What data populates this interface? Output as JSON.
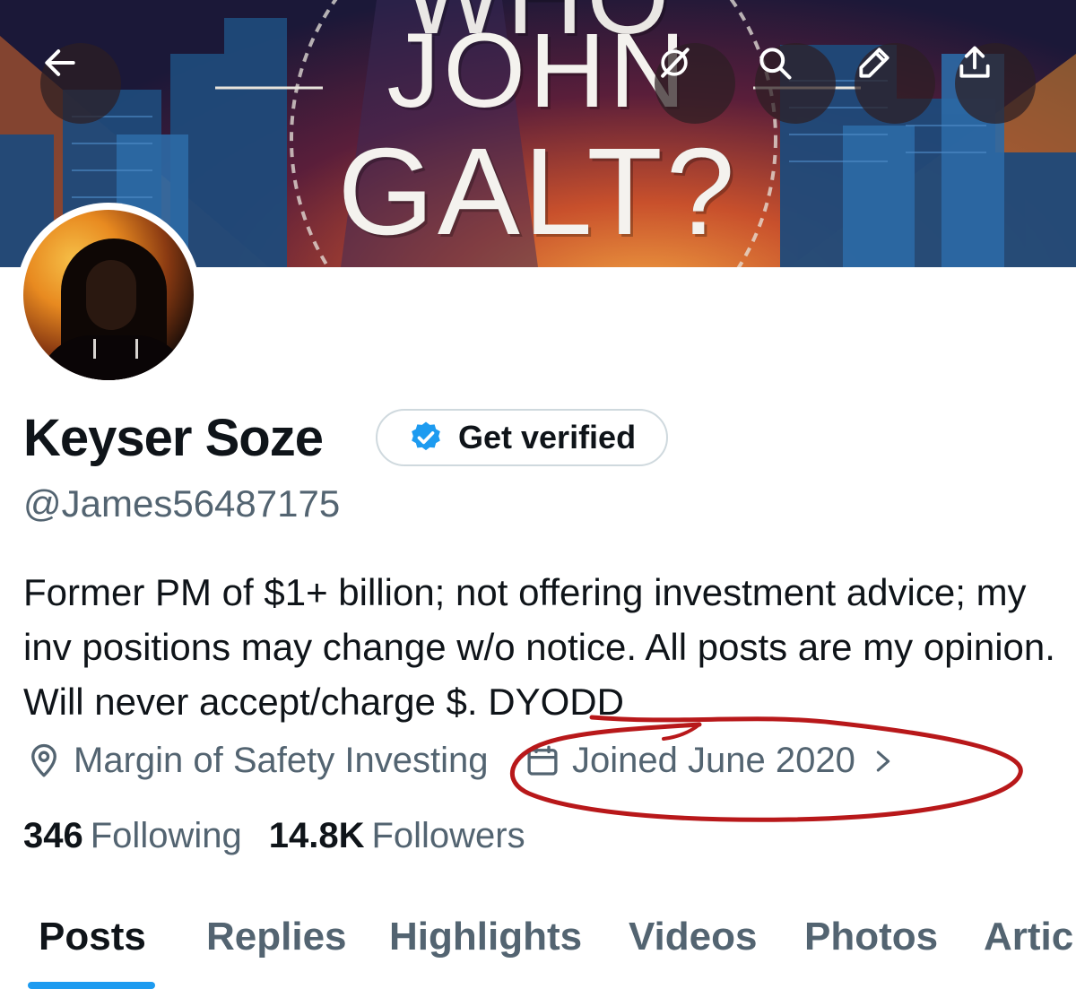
{
  "banner": {
    "title_line1": "WHO",
    "title_line2": "JOHN",
    "title_line3": "GALT?"
  },
  "header_buttons": {
    "back_icon": "arrow-left-icon",
    "grok_icon": "grok-icon",
    "search_icon": "search-icon",
    "edit_icon": "pencil-icon",
    "share_icon": "share-icon"
  },
  "profile": {
    "name": "Keyser Soze",
    "get_verified_label": "Get verified",
    "handle": "@James56487175",
    "bio": "Former PM of $1+ billion; not offering investment advice; my inv positions may change w/o notice. All posts are my opinion. Will never accept/charge $. DYODD",
    "location": "Margin of Safety Investing",
    "joined": "Joined June 2020",
    "following_count": "346",
    "following_label": "Following",
    "followers_count": "14.8K",
    "followers_label": "Followers"
  },
  "tabs": [
    {
      "label": "Posts",
      "active": true
    },
    {
      "label": "Replies",
      "active": false
    },
    {
      "label": "Highlights",
      "active": false
    },
    {
      "label": "Videos",
      "active": false
    },
    {
      "label": "Photos",
      "active": false
    },
    {
      "label": "Artic",
      "active": false
    }
  ],
  "colors": {
    "accent": "#1d9bf0",
    "text_primary": "#0f1419",
    "text_secondary": "#536471",
    "annotation": "#b8181a",
    "verified_badge": "#1d9bf0"
  }
}
